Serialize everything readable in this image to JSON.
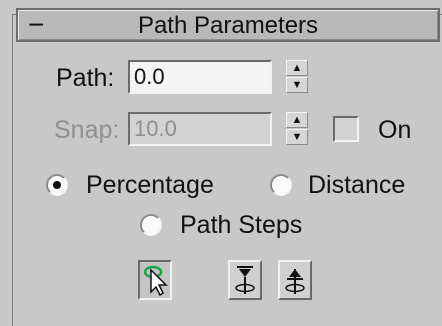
{
  "rollout": {
    "collapse_symbol": "−",
    "title": "Path Parameters"
  },
  "path_row": {
    "label": "Path:",
    "value": "0.0"
  },
  "snap_row": {
    "label": "Snap:",
    "value": "10.0",
    "on_label": "On",
    "on_checked": false,
    "enabled": false
  },
  "mode": {
    "options": [
      {
        "label": "Percentage",
        "selected": true
      },
      {
        "label": "Distance",
        "selected": false
      },
      {
        "label": "Path Steps",
        "selected": false
      }
    ]
  },
  "tool_buttons": [
    {
      "icon": "pick-path-icon",
      "pressed": true
    },
    {
      "icon": "align-pivot-down-icon",
      "pressed": false
    },
    {
      "icon": "align-pivot-up-icon",
      "pressed": false
    }
  ],
  "colors": {
    "panel_bg": "#c8c8c8",
    "field_bg": "#f4f4f4",
    "disabled_text": "#8f8f8f",
    "pick_accent": "#16a64a"
  }
}
